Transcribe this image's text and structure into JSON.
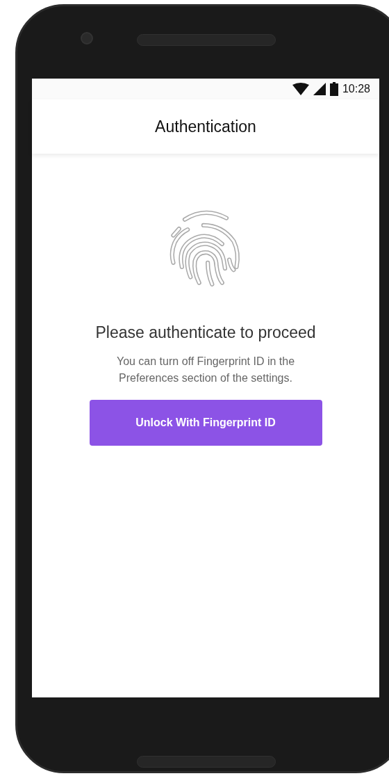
{
  "status_bar": {
    "time": "10:28"
  },
  "app_bar": {
    "title": "Authentication"
  },
  "content": {
    "heading": "Please authenticate to proceed",
    "message": "You can turn off Fingerprint ID in the Preferences section of the settings.",
    "button": "Unlock With Fingerprint ID"
  }
}
